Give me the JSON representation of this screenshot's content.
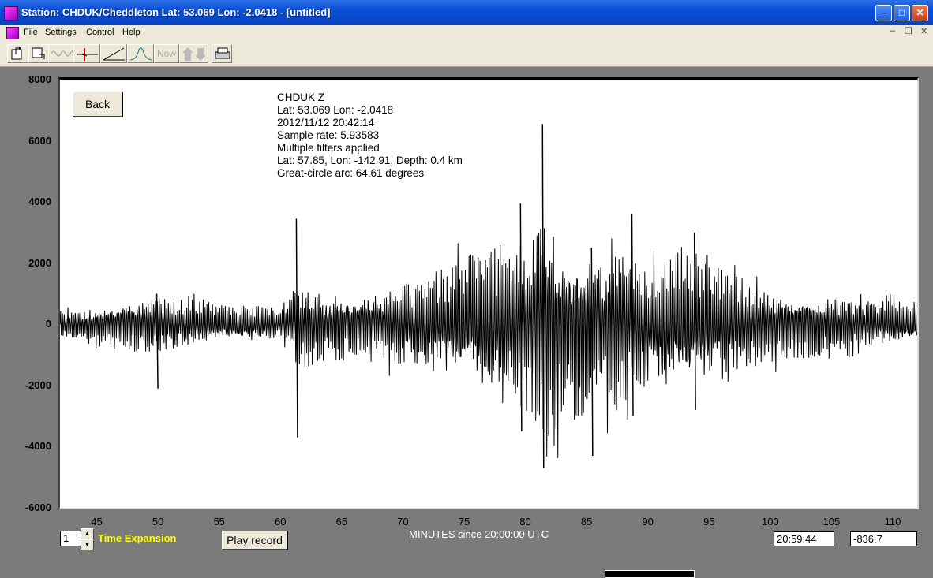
{
  "window": {
    "title": "Station: CHDUK/Cheddleton Lat: 53.069 Lon: -2.0418 - [untitled]"
  },
  "menu": [
    "File",
    "Settings",
    "Control",
    "Help"
  ],
  "toolbar": {
    "now_label": "Now"
  },
  "buttons": {
    "back": "Back",
    "play_record": "Play record"
  },
  "info": {
    "line1": "CHDUK  Z",
    "line2": "Lat: 53.069 Lon: -2.0418",
    "line3": "2012/11/12 20:42:14",
    "line4": "Sample rate: 5.93583",
    "line5": "Multiple filters applied",
    "line6": "Lat: 57.85, Lon: -142.91, Depth: 0.4 km",
    "line7": "Great-circle arc: 64.61 degrees"
  },
  "controls": {
    "time_expansion_value": "1",
    "time_expansion_label": "Time Expansion",
    "cursor_time": "20:59:44",
    "cursor_value": "-836.7"
  },
  "chart_data": {
    "type": "line",
    "xlabel": "MINUTES since 20:00:00 UTC",
    "ylabel": "",
    "xlim": [
      42,
      112
    ],
    "ylim": [
      -6000,
      8000
    ],
    "x_ticks": [
      45,
      50,
      55,
      60,
      65,
      70,
      75,
      80,
      85,
      90,
      95,
      100,
      105,
      110
    ],
    "y_ticks": [
      8000,
      6000,
      4000,
      2000,
      0,
      -2000,
      -4000,
      -6000
    ],
    "series": [
      {
        "envelope_x": [
          42,
          45,
          48,
          50,
          55,
          60,
          61.3,
          63,
          65,
          70,
          75,
          78,
          80,
          81.4,
          83,
          85,
          88,
          90,
          94,
          96,
          100,
          105,
          110,
          112
        ],
        "envelope_amp": [
          500,
          700,
          1000,
          1100,
          700,
          600,
          1800,
          1300,
          1200,
          1500,
          2200,
          2800,
          3200,
          4500,
          3200,
          3000,
          3000,
          2500,
          2600,
          2100,
          1300,
          1000,
          800,
          700
        ],
        "spikes": [
          {
            "x": 61.3,
            "max": 3450,
            "min": -3700
          },
          {
            "x": 49.9,
            "max": 1000,
            "min": -2100
          },
          {
            "x": 81.4,
            "max": 6550,
            "min": -4700
          },
          {
            "x": 79.6,
            "max": 3950,
            "min": -3500
          },
          {
            "x": 85.4,
            "max": 2500,
            "min": -4300
          },
          {
            "x": 88.7,
            "max": 3600,
            "min": -3000
          },
          {
            "x": 93.8,
            "max": 3000,
            "min": -2800
          }
        ]
      }
    ],
    "grid": false
  }
}
